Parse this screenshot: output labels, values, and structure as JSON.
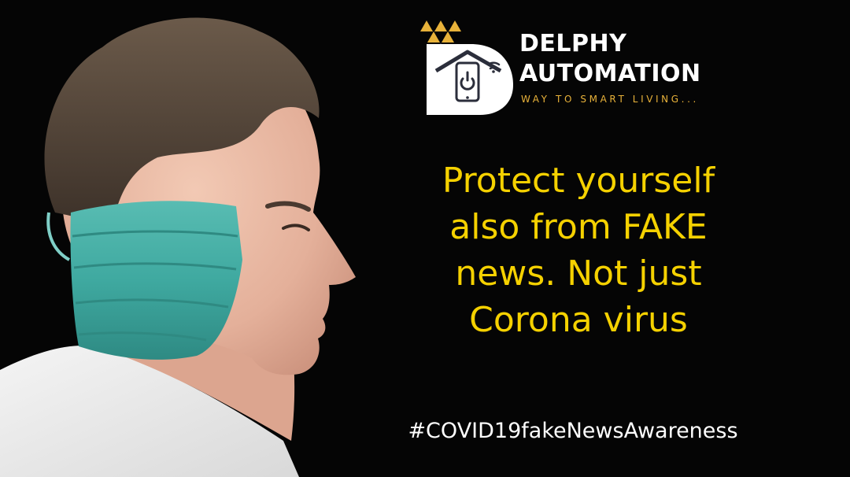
{
  "logo": {
    "line1": "DELPHY",
    "line2": "AUTOMATION",
    "tagline": "WAY TO SMART LIVING...",
    "colors": {
      "gold": "#e8b23a",
      "dark": "#2b2e3b",
      "mark_bg": "#ffffff"
    },
    "icons": [
      "house-roof-icon",
      "smartphone-icon",
      "power-icon",
      "wifi-icon",
      "triangle-pattern-icon"
    ]
  },
  "headline": {
    "lines": [
      "Protect yourself",
      "also from FAKE",
      "news. Not just",
      "Corona virus"
    ],
    "color": "#f5d100"
  },
  "hashtag": "#COVID19fakeNewsAwareness",
  "colors": {
    "background": "#050505",
    "mask": "#3fa9a0",
    "text_white": "#ffffff"
  }
}
